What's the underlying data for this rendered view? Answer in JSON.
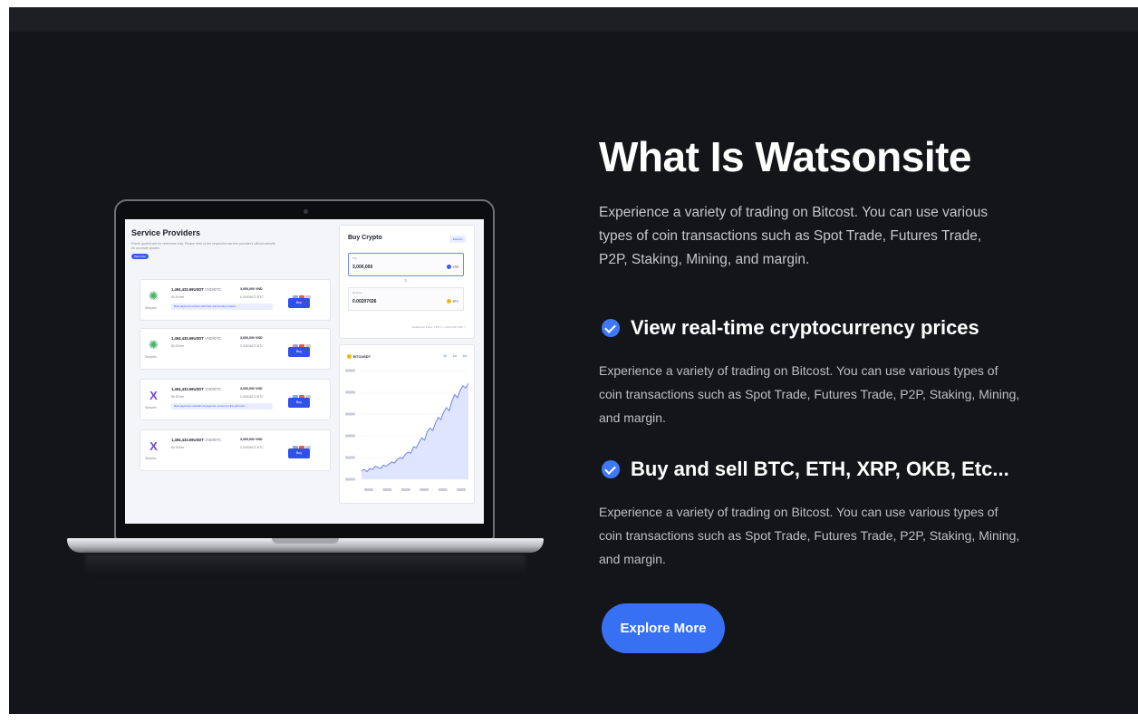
{
  "section": {
    "title": "What Is Watsonsite",
    "intro": "Experience a variety of trading on Bitcost. You can use various types of coin transactions such as Spot Trade, Futures Trade, P2P, Staking, Mining, and margin.",
    "features": [
      {
        "title": "View real-time cryptocurrency prices",
        "text": "Experience a variety of trading on Bitcost. You can use various types of coin transactions such as Spot Trade, Futures Trade, P2P, Staking, Mining, and margin."
      },
      {
        "title": "Buy and sell BTC, ETH, XRP, OKB, Etc...",
        "text": "Experience a variety of trading on Bitcost. You can use various types of coin transactions such as Spot Trade, Futures Trade, P2P, Staking, Mining, and margin."
      }
    ],
    "cta_label": "Explore More",
    "accent_color": "#3870f4"
  },
  "mockup": {
    "service_providers": {
      "title": "Service Providers",
      "description": "Prices quoted are for reference only. Please refer to the respective service provider's official website for accurate quotes.",
      "pill": "Best rate",
      "providers": [
        {
          "logo": "✺",
          "logo_color": "green",
          "name": "Simplex",
          "rate": "1,494,433.69USDT",
          "pair": " VND/BTC",
          "fee": "$0.00 fee",
          "amount": "3,000,000 VND",
          "amount2": "0.00204672 BTC",
          "buy": "Buy",
          "note": "Best payment solution with fast and simple process"
        },
        {
          "logo": "✺",
          "logo_color": "green",
          "name": "Simplex",
          "rate": "1,494,433.69USDT",
          "pair": " VND/BTC",
          "fee": "$0.00 fee",
          "amount": "3,000,000 VND",
          "amount2": "0.00204672 BTC",
          "buy": "Buy",
          "note": ""
        },
        {
          "logo": "X",
          "logo_color": "purple",
          "name": "Simplex",
          "rate": "1,494,433.69USDT",
          "pair": " VND/BTC",
          "fee": "$0.00 fee",
          "amount": "3,000,000 VND",
          "amount2": "0.00204672 BTC",
          "buy": "Buy",
          "note": "Best payment methods as payouts, convert to fiat, gift card..."
        },
        {
          "logo": "X",
          "logo_color": "purple",
          "name": "Simplex",
          "rate": "1,494,433.69USDT",
          "pair": " VND/BTC",
          "fee": "$0.00 fee",
          "amount": "3,000,000 VND",
          "amount2": "0.00204672 BTC",
          "buy": "Buy",
          "note": ""
        }
      ]
    },
    "buy_crypto": {
      "title": "Buy Crypto",
      "badge": "Refresh",
      "pay_label": "Pay",
      "pay_value": "3,000,000",
      "pay_currency": "VND",
      "receive_label": "Receive",
      "receive_value": "0.00207026",
      "receive_currency": "BTC",
      "swap_icon": "⇅",
      "reference": "Reference Price: 1 BTC ≈ 1,449,433 VND ↗"
    },
    "chart_card": {
      "pair": "BTCUSDT",
      "tabs": [
        "1h",
        "1d",
        "1w"
      ]
    },
    "chart_data": {
      "type": "area",
      "title": "",
      "xlabel": "",
      "ylabel": "",
      "x": [
        0,
        1,
        2,
        3,
        4,
        5,
        6,
        7,
        8,
        9,
        10,
        11,
        12,
        13,
        14,
        15,
        16,
        17,
        18,
        19,
        20,
        21,
        22,
        23,
        24,
        25,
        26,
        27,
        28,
        29,
        30,
        31,
        32,
        33,
        34,
        35,
        36,
        37,
        38,
        39
      ],
      "values": [
        8,
        9,
        7,
        10,
        9,
        12,
        11,
        10,
        13,
        12,
        14,
        16,
        15,
        18,
        20,
        19,
        23,
        25,
        24,
        30,
        29,
        34,
        38,
        36,
        44,
        47,
        45,
        52,
        57,
        55,
        62,
        66,
        63,
        72,
        78,
        75,
        82,
        86,
        84,
        88
      ],
      "ylim": [
        0,
        100
      ],
      "grid": true,
      "line_color": "#6f83f4",
      "fill_color": "#dfe5ff"
    }
  }
}
